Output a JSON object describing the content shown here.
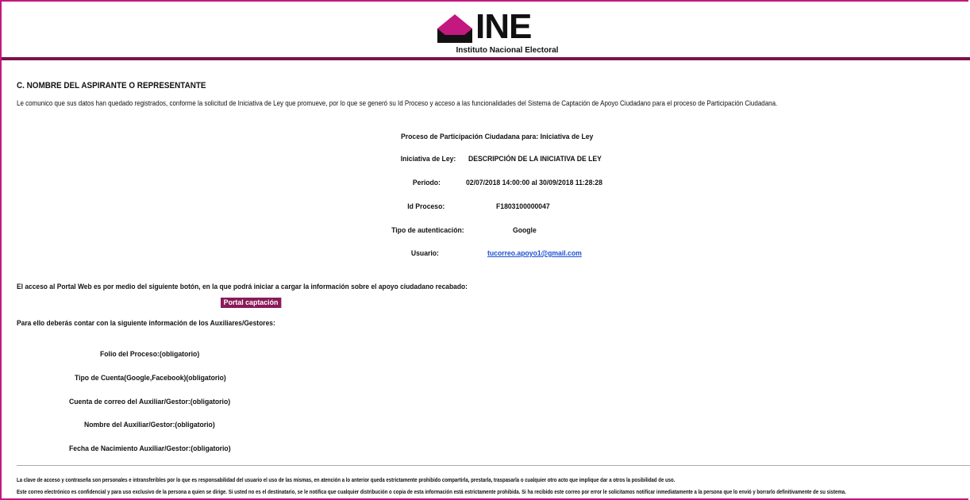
{
  "header": {
    "logo_word": "INE",
    "logo_subtitle": "Instituto Nacional Electoral",
    "colors": {
      "brand_magenta": "#c2187f",
      "band": "#7a1248",
      "button": "#8a1a5a"
    }
  },
  "section": {
    "title": "C.  NOMBRE DEL ASPIRANTE O REPRESENTANTE",
    "intro": "Le comunico que sus datos han quedado registrados, conforme la solicitud de Iniciativa de Ley que promueve, por lo que se generó su Id Proceso y acceso a las funcionalidades del Sistema de Captación de Apoyo Ciudadano para el proceso de Participación Ciudadana."
  },
  "details": {
    "process_heading": "Proceso de Participación Ciudadana para: Iniciativa de Ley",
    "iniciativa_label": "Iniciativa de Ley:",
    "iniciativa_value": "DESCRIPCIÓN DE LA INICIATIVA DE LEY",
    "periodo_label": "Periodo:",
    "periodo_value": "02/07/2018 14:00:00 al 30/09/2018 11:28:28",
    "id_label": "Id Proceso:",
    "id_value": "F1803100000047",
    "auth_label": "Tipo de autenticación:",
    "auth_value": "Google",
    "user_label": "Usuario:",
    "user_value": "tucorreo.apoyo1@gmail.com"
  },
  "access": {
    "text": "El acceso al Portal Web es por medio del siguiente botón, en la que podrá iniciar a cargar la información sobre el apoyo ciudadano recabado:",
    "button_label": "Portal captación",
    "info_intro": "Para ello deberás contar con la siguiente información de los Auxiliares/Gestores:"
  },
  "requirements": [
    "Folio del Proceso:(obligatorio)",
    "Tipo de Cuenta(Google,Facebook)(obligatorio)",
    "Cuenta de correo del Auxiliar/Gestor:(obligatorio)",
    "Nombre del Auxiliar/Gestor:(obligatorio)",
    "Fecha de Nacimiento Auxiliar/Gestor:(obligatorio)"
  ],
  "footer": {
    "line1": "La clave de acceso y contraseña son personales e intransferibles por lo que es responsabilidad del usuario el uso de las mismas, en atención a lo anterior queda estrictamente prohibido compartirla, prestarla, traspasarla o cualquier otro acto que implique dar a otros la posibilidad de uso.",
    "line2": "Este correo electrónico es confidencial y para uso exclusivo de la persona a quien se dirige. Si usted no es el destinatario, se le notifica que cualquier distribución o copia de esta información está estrictamente prohibida. Si ha recibido este correo por error le solicitamos notificar inmediatamente a la persona que lo envió y borrarlo definitivamente de su sistema."
  }
}
